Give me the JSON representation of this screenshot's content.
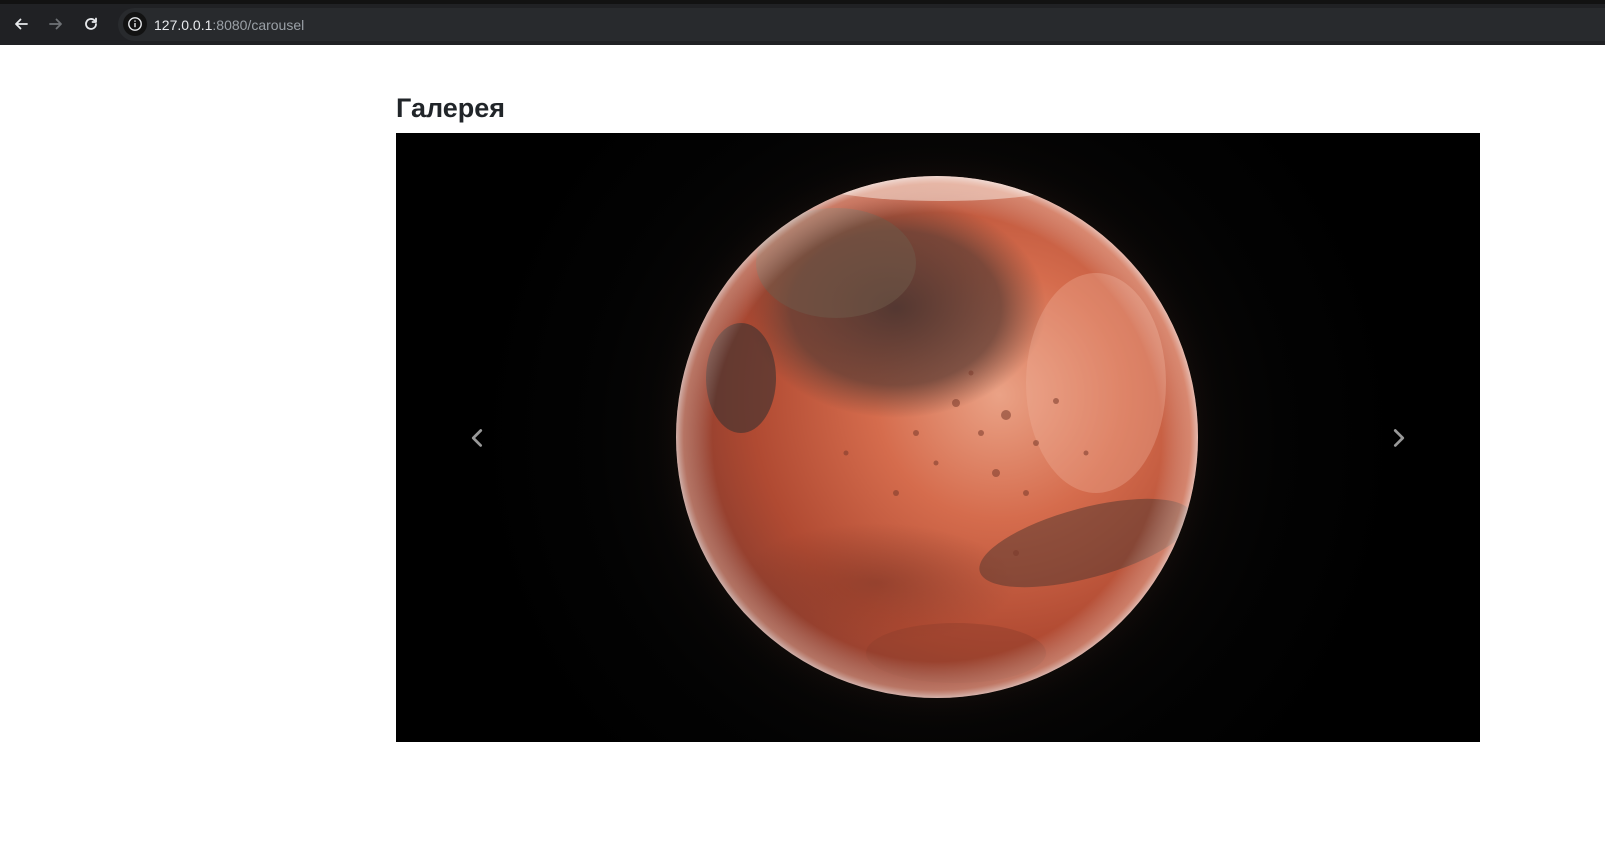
{
  "browser": {
    "url_host": "127.0.0.1",
    "url_path": ":8080/carousel",
    "icons": {
      "back": "arrow-left-icon",
      "forward": "arrow-right-icon",
      "reload": "reload-icon",
      "site_info": "info-icon"
    }
  },
  "page": {
    "title": "Галерея"
  },
  "carousel": {
    "slide_image": "planet-mars-image",
    "controls": {
      "prev_icon": "chevron-left-icon",
      "next_icon": "chevron-right-icon"
    },
    "colors": {
      "background": "#000000",
      "planet_base": "#c8573a",
      "planet_highlight": "#f0a487",
      "planet_dark": "#5a3a32"
    }
  }
}
